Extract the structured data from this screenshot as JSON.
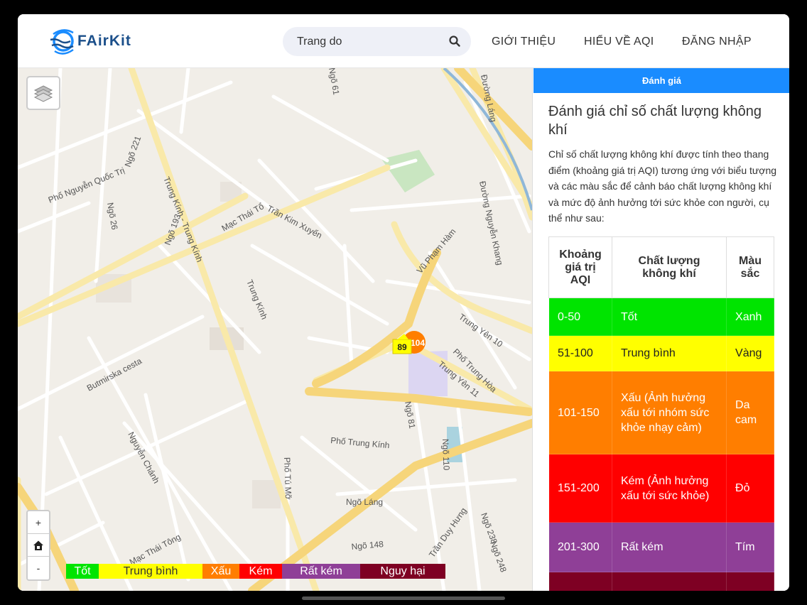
{
  "brand": {
    "name": "FAirKit"
  },
  "search": {
    "placeholder": "Trang do"
  },
  "nav": {
    "items": [
      "GIỚI THIỆU",
      "HIỂU VỀ AQI",
      "ĐĂNG NHẬP"
    ]
  },
  "map": {
    "zoom_in": "+",
    "zoom_out": "-",
    "street_labels": [
      "Phố Nguyễn Quốc Trị",
      "Trung Kính - Trung Kính",
      "Mạc Thái Tổ",
      "Trần Kim Xuyến",
      "Vũ Phạm Hàm",
      "Đường Láng",
      "Đường Nguyễn Khang",
      "Trung Yên 10",
      "Phố Trung Hòa",
      "Trung Yên 11",
      "Butmirska cesta",
      "Trung Kính",
      "Phố Trung Kính",
      "Nguyễn Chánh",
      "Ngõ Láng",
      "Mạc Thái Tông",
      "Phố Tú Mỡ",
      "Trần Duy Hưng",
      "Ngõ 26",
      "Ngõ 193",
      "Ngõ 221",
      "Ngõ 81",
      "Ngõ 110",
      "Ngõ 148",
      "Ngõ 238",
      "Ngõ 248",
      "Ngõ 61"
    ],
    "markers": [
      {
        "value": "89",
        "color": "#ffff00"
      },
      {
        "value": "104",
        "color": "#ff7e00"
      }
    ],
    "legend": [
      {
        "label": "Tốt",
        "color": "#00e400"
      },
      {
        "label": "Trung bình",
        "color": "#ffff00"
      },
      {
        "label": "Xấu",
        "color": "#ff7e00"
      },
      {
        "label": "Kém",
        "color": "#ff0000"
      },
      {
        "label": "Rất kém",
        "color": "#8f3f97"
      },
      {
        "label": "Nguy hại",
        "color": "#7e0023"
      }
    ]
  },
  "panel": {
    "tab": "Đánh giá",
    "title": "Đánh giá chỉ số chất lượng không khí",
    "description": "Chỉ số chất lượng không khí được tính theo thang điểm (khoảng giá trị AQI) tương ứng với biểu tượng và các màu sắc để cảnh báo chất lượng không khí và mức độ ảnh hưởng tới sức khỏe con người, cụ thể như sau:",
    "table": {
      "headers": [
        "Khoảng giá trị AQI",
        "Chất lượng không khí",
        "Màu sắc"
      ],
      "rows": [
        {
          "range": "0-50",
          "quality": "Tốt",
          "color_name": "Xanh",
          "bg": "#00e400"
        },
        {
          "range": "51-100",
          "quality": "Trung bình",
          "color_name": "Vàng",
          "bg": "#ffff00"
        },
        {
          "range": "101-150",
          "quality": "Xấu (Ảnh hưởng xấu tới nhóm sức khỏe nhạy cảm)",
          "color_name": "Da cam",
          "bg": "#ff7e00"
        },
        {
          "range": "151-200",
          "quality": "Kém (Ảnh hưởng xấu tới sức khỏe)",
          "color_name": "Đỏ",
          "bg": "#ff0000"
        },
        {
          "range": "201-300",
          "quality": "Rất kém",
          "color_name": "Tím",
          "bg": "#8f3f97"
        },
        {
          "range": "",
          "quality": "",
          "color_name": "",
          "bg": "#7e0023"
        }
      ]
    }
  }
}
